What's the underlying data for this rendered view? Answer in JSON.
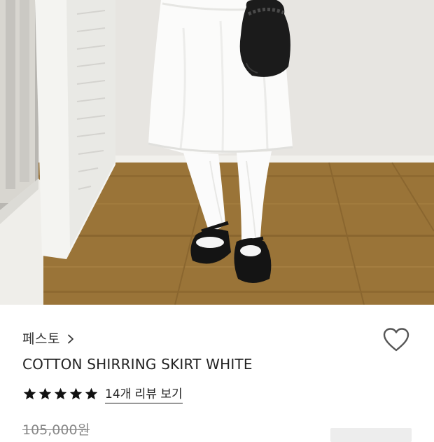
{
  "product": {
    "brand": "페스토",
    "title": "COTTON SHIRRING SKIRT WHITE",
    "rating_stars": 5,
    "reviews_link": "14개 리뷰 보기",
    "original_price": "105,000원"
  },
  "icons": {
    "brand_chevron": "chevron-right-icon",
    "wishlist": "heart-outline-icon",
    "rating": "star-filled-icon"
  },
  "colors": {
    "text": "#222222",
    "muted": "#888888",
    "star": "#111111"
  }
}
